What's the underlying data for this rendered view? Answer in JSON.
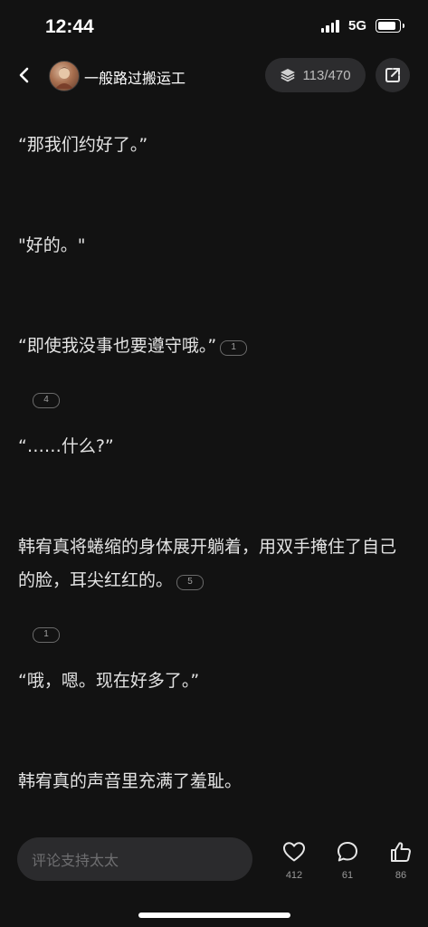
{
  "status_bar": {
    "time": "12:44",
    "network": "5G"
  },
  "header": {
    "author": "一般路过搬运工",
    "chapter_progress": "113/470"
  },
  "paragraphs": {
    "p1": "“那我们约好了。”",
    "p2": "\"好的。\"",
    "p3": "“即使我没事也要遵守哦。”",
    "p3_comments": "1",
    "p3_extra_comments": "4",
    "p4": "“……什么?”",
    "p5": "韩宥真将蜷缩的身体展开躺着，用双手掩住了自己的脸，耳尖红红的。",
    "p5_comments": "5",
    "p5_extra_comments": "1",
    "p6": "“哦，嗯。现在好多了。”",
    "p7": "韩宥真的声音里充满了羞耻。"
  },
  "bottom_bar": {
    "comment_placeholder": "评论支持太太",
    "like_count": "412",
    "comment_count": "61",
    "thumbs_count": "86"
  },
  "colors": {
    "background": "#121212",
    "text": "#e3e3e3",
    "pill": "#2c2c2e",
    "muted": "#9a9a9a"
  },
  "icons": [
    "back-icon",
    "layers-icon",
    "share-icon",
    "heart-icon",
    "comment-icon",
    "thumbs-up-icon"
  ]
}
